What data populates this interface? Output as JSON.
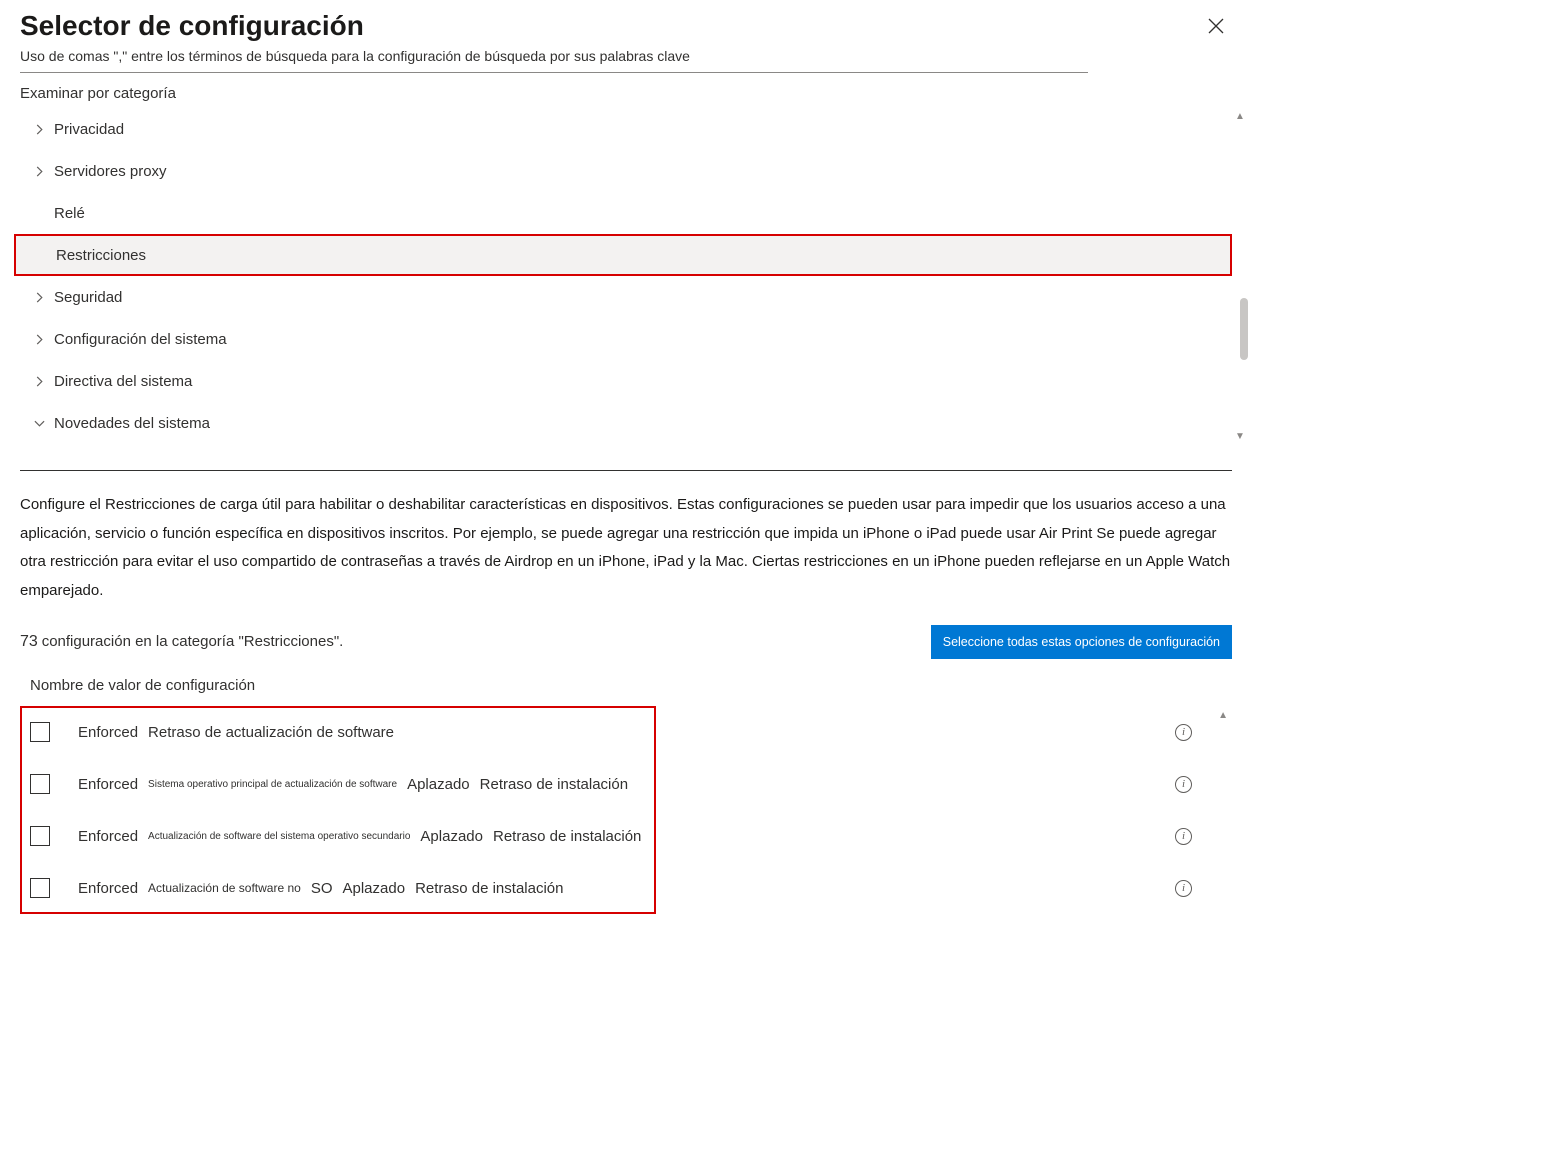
{
  "header": {
    "title": "Selector de configuración",
    "subtitle": "Uso de comas  \",\"  entre los términos de búsqueda para la configuración de búsqueda por sus palabras clave"
  },
  "browse_label": "Examinar por categoría",
  "categories": [
    {
      "label": "Privacidad",
      "expandable": true,
      "expanded": false,
      "highlight": false
    },
    {
      "label": "Servidores proxy",
      "expandable": true,
      "expanded": false,
      "highlight": false
    },
    {
      "label": "Relé",
      "expandable": false,
      "expanded": false,
      "highlight": false
    },
    {
      "label": "Restricciones",
      "expandable": false,
      "expanded": false,
      "highlight": true
    },
    {
      "label": "Seguridad",
      "expandable": true,
      "expanded": false,
      "highlight": false
    },
    {
      "label": "Configuración del sistema",
      "expandable": true,
      "expanded": false,
      "highlight": false
    },
    {
      "label": "Directiva del sistema",
      "expandable": true,
      "expanded": false,
      "highlight": false
    },
    {
      "label": "Novedades del sistema",
      "expandable": true,
      "expanded": true,
      "highlight": false
    }
  ],
  "description": "Configure el      Restricciones de carga útil para habilitar o deshabilitar características en dispositivos. Estas configuraciones se pueden usar para impedir que los usuarios acceso a una aplicación, servicio o función específica en dispositivos inscritos.       Por ejemplo, se puede agregar una restricción que impida un iPhone o iPad puede usar Air Print Se puede agregar otra restricción para evitar el uso compartido de contraseñas a través de Airdrop en un iPhone, iPad y la     Mac. Ciertas restricciones en un iPhone pueden reflejarse en un Apple Watch emparejado.",
  "count": {
    "number": "73",
    "text": "configuración en la categoría \"Restricciones\"."
  },
  "select_all_button": "Seleccione todas estas opciones de configuración",
  "column_header": "Nombre de valor de configuración",
  "enforced_label": "Enforced",
  "settings": [
    {
      "parts": [
        "Retraso de actualización de software"
      ],
      "sizes": [
        "normal"
      ]
    },
    {
      "parts": [
        "Sistema operativo principal de actualización de software",
        "Aplazado",
        "Retraso de instalación"
      ],
      "sizes": [
        "small",
        "normal",
        "normal"
      ]
    },
    {
      "parts": [
        "Actualización de software del sistema operativo secundario",
        "Aplazado",
        "Retraso de instalación"
      ],
      "sizes": [
        "small",
        "normal",
        "normal"
      ]
    },
    {
      "parts": [
        "Actualización de software no",
        "SO",
        "Aplazado",
        "Retraso de instalación"
      ],
      "sizes": [
        "small2",
        "normal",
        "normal",
        "normal"
      ]
    }
  ]
}
